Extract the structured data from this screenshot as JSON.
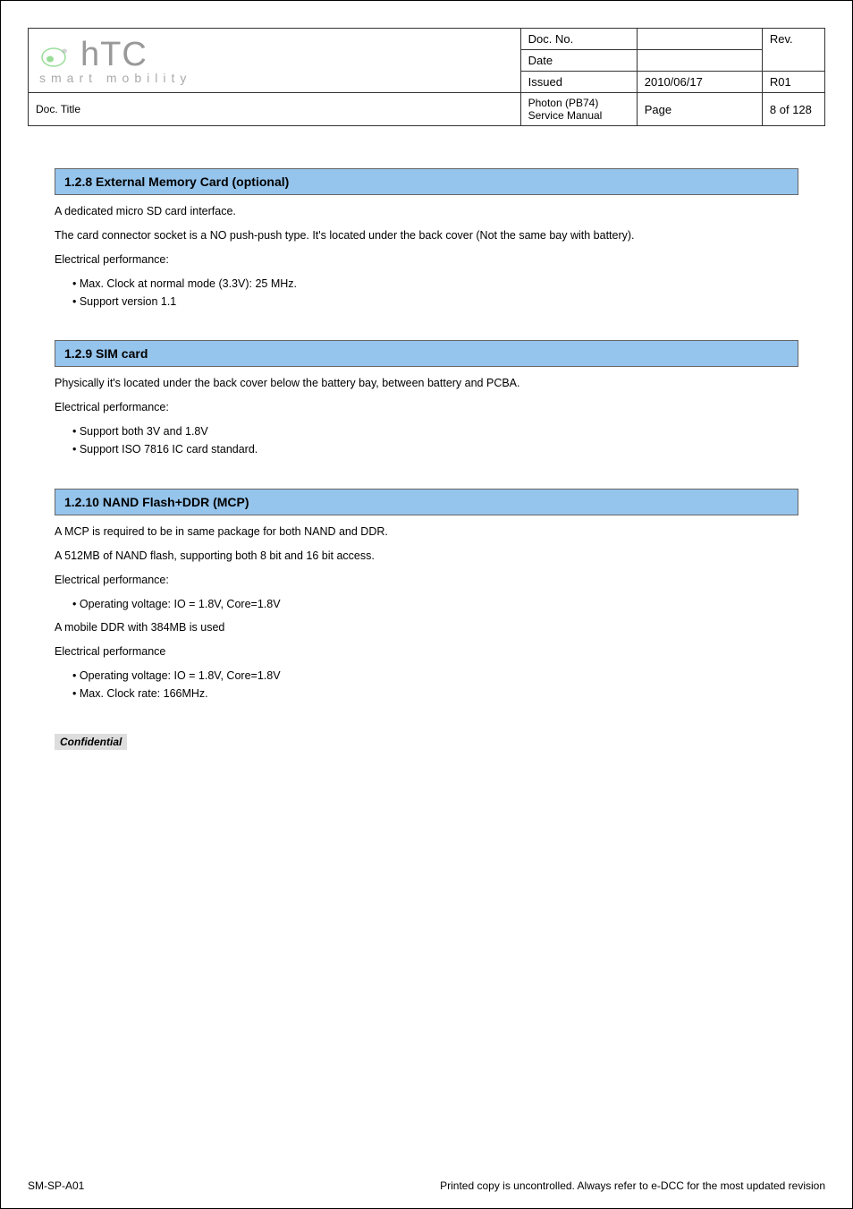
{
  "header": {
    "logo_brand": "hTC",
    "logo_tagline": "smart mobility",
    "doc_title_label": "Doc. Title",
    "doc_title": "Photon (PB74) Service Manual",
    "doc_no_label": "Doc. No.",
    "doc_no": "",
    "rev_label": "Rev.",
    "rev": "R01",
    "date_label": "Date",
    "date": "",
    "issued_label": "Issued",
    "issued": "2010/06/17",
    "page_label": "Page",
    "page": "8 of 128"
  },
  "sections": {
    "s1": {
      "title": "1.2.8 External Memory Card (optional)",
      "p1": "A dedicated micro SD card interface.",
      "p2": "The card connector socket is a NO push-push type. It's located under the back cover (Not the same bay with battery).",
      "p3": "Electrical performance:",
      "b1": "• Max. Clock at normal mode (3.3V): 25 MHz.",
      "b2": "• Support version 1.1"
    },
    "s2": {
      "title": "1.2.9 SIM card",
      "p1": "Physically it's located under the back cover below the battery bay, between battery and PCBA.",
      "p2": "Electrical performance:",
      "b1": "• Support both 3V and 1.8V",
      "b2": "• Support ISO 7816 IC card standard."
    },
    "s3": {
      "title": "1.2.10 NAND Flash+DDR (MCP)",
      "p1": "A MCP is required to be in same package for both NAND and DDR.",
      "p2": "A 512MB of NAND flash, supporting both 8 bit and 16 bit access.",
      "p3": "Electrical performance:",
      "b1": "• Operating voltage: IO = 1.8V, Core=1.8V",
      "p4": "A mobile DDR with 384MB is used",
      "p5": "Electrical performance",
      "b2": "• Operating voltage: IO = 1.8V, Core=1.8V",
      "b3": "• Max. Clock rate: 166MHz."
    }
  },
  "confidential": "Confidential",
  "footer": {
    "left": "SM-SP-A01",
    "right": "Printed copy is uncontrolled. Always refer to e-DCC for the most updated revision"
  }
}
